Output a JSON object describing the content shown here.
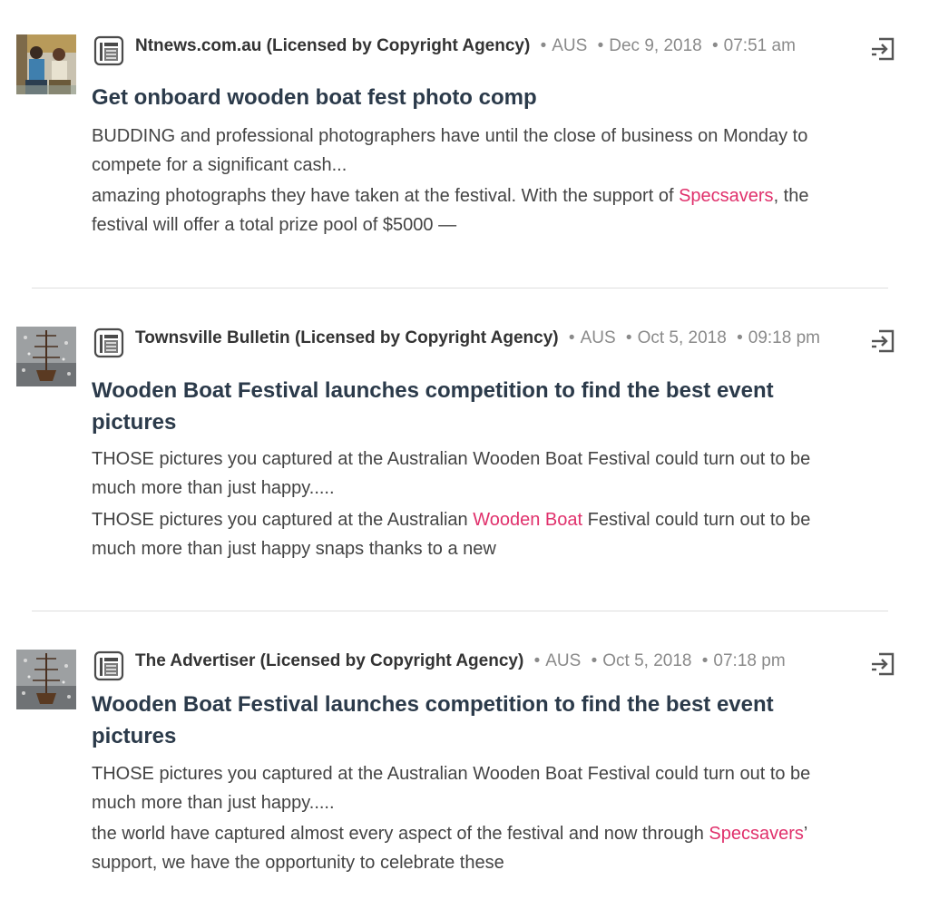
{
  "articles": [
    {
      "source": "Ntnews.com.au (Licensed by Copyright Agency)",
      "country": "AUS",
      "date": "Dec 9, 2018",
      "time": "07:51 am",
      "title": "Get onboard wooden boat fest photo comp",
      "summary": "BUDDING and professional photographers have until the close of business on Monday to compete for a significant cash...",
      "snippet_before": "amazing photographs they have taken at the festival. With the support of ",
      "snippet_highlight": "Specsavers",
      "snippet_after": ", the festival will offer a total prize pool of $5000 —",
      "thumbnail_icon": "people-photo-thumbnail",
      "source_icon": "newspaper-icon",
      "action_icon": "open-in-icon"
    },
    {
      "source": "Townsville Bulletin (Licensed by Copyright Agency)",
      "country": "AUS",
      "date": "Oct 5, 2018",
      "time": "09:18 pm",
      "title": "Wooden Boat Festival launches competition to find the best event pictures",
      "summary": "THOSE pictures you captured at the Australian Wooden Boat Festival could turn out to be much more than just happy.....",
      "snippet_before": "THOSE pictures you captured at the Australian ",
      "snippet_highlight": "Wooden Boat",
      "snippet_after": " Festival could turn out to be much more than just happy snaps thanks to a new",
      "thumbnail_icon": "boat-photo-thumbnail",
      "source_icon": "newspaper-icon",
      "action_icon": "open-in-icon"
    },
    {
      "source": "The Advertiser (Licensed by Copyright Agency)",
      "country": "AUS",
      "date": "Oct 5, 2018",
      "time": "07:18 pm",
      "title": "Wooden Boat Festival launches competition to find the best event pictures",
      "summary": "THOSE pictures you captured at the Australian Wooden Boat Festival could turn out to be much more than just happy.....",
      "snippet_before": "the world have captured almost every aspect of the festival and now through ",
      "snippet_highlight": "Specsavers",
      "snippet_after": "’ support, we have the opportunity to celebrate these",
      "thumbnail_icon": "boat-photo-thumbnail",
      "source_icon": "newspaper-icon",
      "action_icon": "open-in-icon"
    }
  ],
  "separator": "•",
  "colors": {
    "highlight": "#e0316c",
    "title": "#2b3a4a",
    "meta": "#8a8a8a",
    "divider": "#dedede"
  }
}
